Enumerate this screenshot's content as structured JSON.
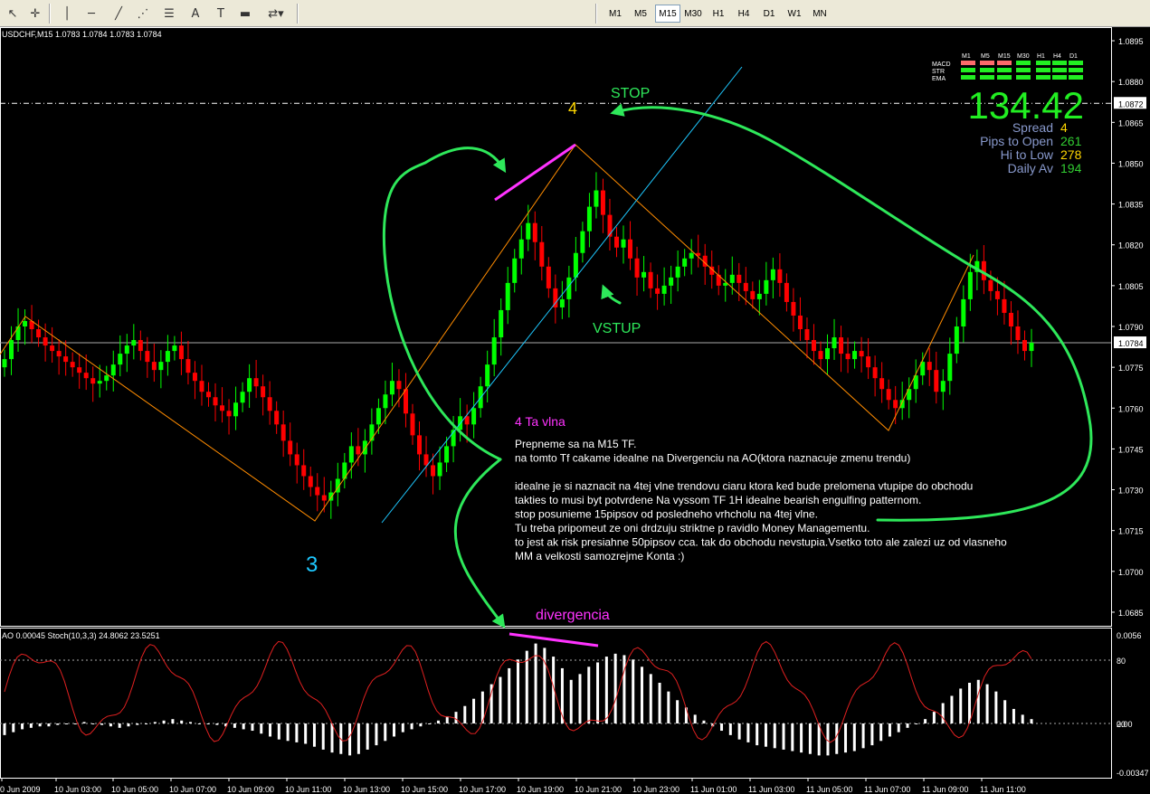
{
  "toolbar": {
    "tools": [
      {
        "name": "arrow-cursor-icon",
        "glyph": "↖"
      },
      {
        "name": "crosshair-icon",
        "glyph": "✛"
      },
      {
        "name": "vertical-line-icon",
        "glyph": "│"
      },
      {
        "name": "horizontal-line-icon",
        "glyph": "─"
      },
      {
        "name": "trendline-icon",
        "glyph": "╱"
      },
      {
        "name": "fibonacci-fan-icon",
        "glyph": "⋰"
      },
      {
        "name": "fibonacci-retracement-icon",
        "glyph": "☰"
      },
      {
        "name": "text-icon",
        "glyph": "A"
      },
      {
        "name": "text-label-icon",
        "glyph": "T"
      },
      {
        "name": "rectangle-icon",
        "glyph": "▬"
      },
      {
        "name": "arrows-menu-icon",
        "glyph": "⇄▾"
      }
    ],
    "timeframes": [
      "M1",
      "M5",
      "M15",
      "M30",
      "H1",
      "H4",
      "D1",
      "W1",
      "MN"
    ],
    "active_timeframe": "M15"
  },
  "chart_header": "USDCHF,M15  1.0783 1.0784 1.0783 1.0784",
  "indicator_header": "AO 0.00045  Stoch(10,3,3) 24.8062 23.5251",
  "price_axis": {
    "labels": [
      "1.0895",
      "1.0880",
      "1.0865",
      "1.0850",
      "1.0835",
      "1.0820",
      "1.0805",
      "1.0790",
      "1.0775",
      "1.0760",
      "1.0745",
      "1.0730",
      "1.0715",
      "1.0700",
      "1.0685"
    ],
    "stop_line_label": "1.0872",
    "current_price_label": "1.0784"
  },
  "indicator_axis": [
    "0.0056",
    "80",
    "0.00",
    "20",
    "-0.00347"
  ],
  "time_axis": [
    "0 Jun 2009",
    "10 Jun 03:00",
    "10 Jun 05:00",
    "10 Jun 07:00",
    "10 Jun 09:00",
    "10 Jun 11:00",
    "10 Jun 13:00",
    "10 Jun 15:00",
    "10 Jun 17:00",
    "10 Jun 19:00",
    "10 Jun 21:00",
    "10 Jun 23:00",
    "11 Jun 01:00",
    "11 Jun 03:00",
    "11 Jun 05:00",
    "11 Jun 07:00",
    "11 Jun 09:00",
    "11 Jun 11:00"
  ],
  "info_panel": {
    "tf_headers": [
      "M1",
      "M5",
      "M15",
      "M30",
      "H1",
      "H4",
      "D1"
    ],
    "rows": [
      "MACD",
      "STR",
      "EMA"
    ],
    "price": "134.42",
    "stats": [
      {
        "label": "Spread",
        "value": "4",
        "color": "#ffd700"
      },
      {
        "label": "Pips to Open",
        "value": "261",
        "color": "#32cd32"
      },
      {
        "label": "Hi to Low",
        "value": "278",
        "color": "#ffd700"
      },
      {
        "label": "Daily Av",
        "value": "194",
        "color": "#32cd32"
      }
    ]
  },
  "annotations": {
    "stop": "STOP",
    "wave4": "4",
    "wave3": "3",
    "vstup": "VSTUP",
    "divergencia": "divergencia",
    "note_title": "4 Ta vlna",
    "note_lines": [
      "Prepneme sa na M15 TF.",
      "na tomto Tf cakame idealne na Divergenciu na AO(ktora naznacuje zmenu trendu)",
      "",
      "idealne je si naznacit na 4tej vlne trendovu ciaru ktora ked bude prelomena vtupipe do obchodu",
      "takties to musi byt potvrdene Na vyssom TF 1H idealne bearish engulfing patternom.",
      "stop posunieme 15pipsov od posledneho vrhcholu na 4tej vlne.",
      "Tu treba pripomeut ze oni drdzuju striktne p ravidlo Money Managementu.",
      "to jest ak risk presiahne 50pipsov cca. tak do obchodu nevstupia.Vsetko toto ale zalezi uz od vlasneho",
      "MM a velkosti samozrejme Konta :)"
    ]
  },
  "chart_data": {
    "type": "candlestick",
    "symbol": "USDCHF",
    "timeframe": "M15",
    "ohlc_header": [
      1.0783,
      1.0784,
      1.0783,
      1.0784
    ],
    "price_range": [
      1.068,
      1.09
    ],
    "current_price": 1.0784,
    "stop_level": 1.0872,
    "closes": [
      1.0778,
      1.0785,
      1.079,
      1.0792,
      1.0789,
      1.0786,
      1.0783,
      1.0781,
      1.0779,
      1.0777,
      1.0775,
      1.0773,
      1.0771,
      1.0769,
      1.077,
      1.0772,
      1.0776,
      1.078,
      1.0783,
      1.0785,
      1.0781,
      1.0777,
      1.0774,
      1.0777,
      1.0781,
      1.0783,
      1.0778,
      1.0773,
      1.077,
      1.0766,
      1.0764,
      1.0761,
      1.0759,
      1.0757,
      1.0762,
      1.0766,
      1.0771,
      1.0768,
      1.0764,
      1.0759,
      1.0754,
      1.0748,
      1.0743,
      1.0739,
      1.0735,
      1.0731,
      1.0728,
      1.0726,
      1.0729,
      1.0734,
      1.074,
      1.0746,
      1.0743,
      1.0748,
      1.0754,
      1.076,
      1.0765,
      1.077,
      1.0767,
      1.0758,
      1.075,
      1.0743,
      1.0739,
      1.0735,
      1.074,
      1.0746,
      1.0752,
      1.0757,
      1.0754,
      1.076,
      1.0768,
      1.0776,
      1.0786,
      1.0796,
      1.0806,
      1.0815,
      1.0822,
      1.0828,
      1.0821,
      1.0812,
      1.0804,
      1.0797,
      1.08,
      1.0808,
      1.0817,
      1.0825,
      1.0834,
      1.084,
      1.0831,
      1.0823,
      1.0819,
      1.0822,
      1.0815,
      1.0808,
      1.081,
      1.0804,
      1.0802,
      1.0805,
      1.0808,
      1.0812,
      1.0815,
      1.0817,
      1.0816,
      1.0812,
      1.0809,
      1.0805,
      1.0806,
      1.0809,
      1.0806,
      1.0803,
      1.08,
      1.0802,
      1.0807,
      1.0811,
      1.0806,
      1.0799,
      1.0794,
      1.0789,
      1.0785,
      1.0781,
      1.0778,
      1.0782,
      1.0786,
      1.078,
      1.0778,
      1.0781,
      1.0779,
      1.0775,
      1.0771,
      1.0767,
      1.0763,
      1.076,
      1.0763,
      1.0767,
      1.0772,
      1.0777,
      1.0774,
      1.0766,
      1.077,
      1.078,
      1.079,
      1.08,
      1.081,
      1.0814,
      1.0807,
      1.0803,
      1.08,
      1.0795,
      1.079,
      1.0785,
      1.0781,
      1.0784
    ],
    "ao_values": [
      -0.0008,
      -0.0006,
      -0.0004,
      -0.0003,
      -0.0002,
      -0.0002,
      -0.0001,
      0,
      0,
      0.0001,
      0,
      -0.0001,
      -0.0002,
      -0.0003,
      -0.0002,
      -0.0001,
      0,
      0.0001,
      0.0002,
      0.0003,
      0.0002,
      0.0001,
      0,
      0,
      -0.0001,
      -0.0002,
      -0.0003,
      -0.0004,
      -0.0005,
      -0.0007,
      -0.0009,
      -0.0011,
      -0.0012,
      -0.0013,
      -0.0014,
      -0.0016,
      -0.0018,
      -0.002,
      -0.0021,
      -0.0022,
      -0.0021,
      -0.0018,
      -0.0015,
      -0.0012,
      -0.0009,
      -0.0006,
      -0.0004,
      -0.0002,
      0,
      0.0002,
      0.0005,
      0.0008,
      0.0012,
      0.0017,
      0.0022,
      0.0027,
      0.0032,
      0.0038,
      0.0044,
      0.005,
      0.0055,
      0.0052,
      0.0046,
      0.0038,
      0.003,
      0.0034,
      0.0039,
      0.0042,
      0.0046,
      0.0048,
      0.0047,
      0.0044,
      0.0039,
      0.0034,
      0.0028,
      0.0022,
      0.0016,
      0.0011,
      0.0006,
      0.0002,
      -0.0002,
      -0.0005,
      -0.0008,
      -0.0011,
      -0.0013,
      -0.0015,
      -0.0016,
      -0.0017,
      -0.0018,
      -0.0019,
      -0.002,
      -0.0021,
      -0.0022,
      -0.0022,
      -0.0021,
      -0.002,
      -0.0019,
      -0.0017,
      -0.0015,
      -0.0012,
      -0.0009,
      -0.0006,
      -0.0003,
      0,
      0.0003,
      0.0008,
      0.0014,
      0.0019,
      0.0024,
      0.0028,
      0.003,
      0.0027,
      0.0022,
      0.0016,
      0.001,
      0.0006,
      0.0003
    ],
    "stochastic": {
      "k": 24.8062,
      "d": 23.5251,
      "levels": [
        20,
        80
      ]
    }
  }
}
